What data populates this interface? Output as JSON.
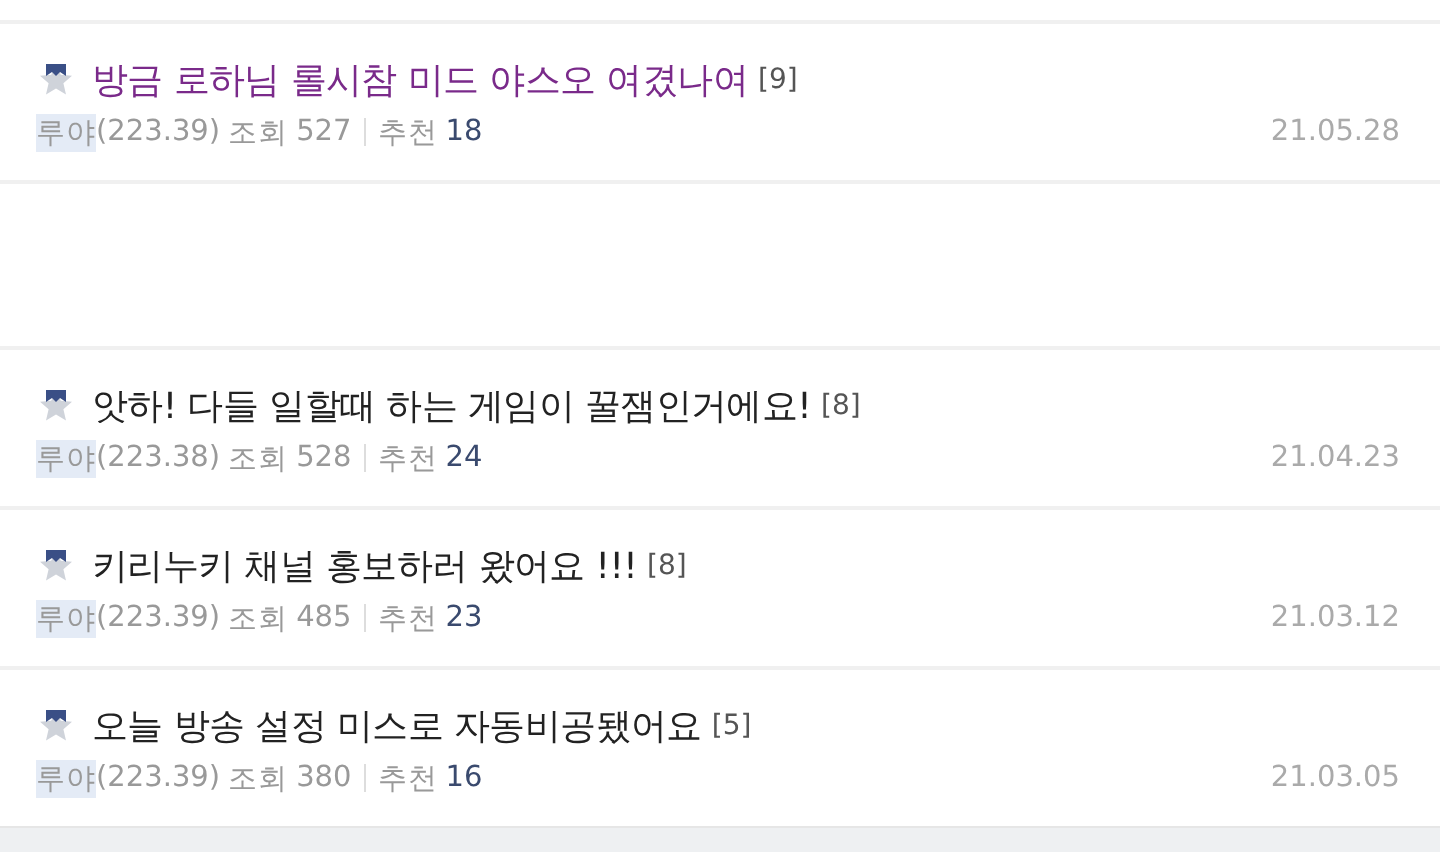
{
  "posts": [
    {
      "kind": "post",
      "title": "방금 로하님 롤시참 미드 야스오 여겼나여",
      "comments": "[9]",
      "visited": true,
      "author": "루야",
      "ip": "(223.39)",
      "views_label": "조회",
      "views": "527",
      "recommend_label": "추천",
      "recommend": "18",
      "date": "21.05.28"
    },
    {
      "kind": "blank"
    },
    {
      "kind": "post",
      "title": "앗하! 다들 일할때 하는 게임이 꿀잼인거에요!",
      "comments": "[8]",
      "visited": false,
      "author": "루야",
      "ip": "(223.38)",
      "views_label": "조회",
      "views": "528",
      "recommend_label": "추천",
      "recommend": "24",
      "date": "21.04.23"
    },
    {
      "kind": "post",
      "title": "키리누키 채널 홍보하러 왔어요 !!!",
      "comments": "[8]",
      "visited": false,
      "author": "루야",
      "ip": "(223.39)",
      "views_label": "조회",
      "views": "485",
      "recommend_label": "추천",
      "recommend": "23",
      "date": "21.03.12"
    },
    {
      "kind": "post",
      "title": "오늘 방송 설정 미스로 자동비공됐어요",
      "comments": "[5]",
      "visited": false,
      "author": "루야",
      "ip": "(223.39)",
      "views_label": "조회",
      "views": "380",
      "recommend_label": "추천",
      "recommend": "16",
      "date": "21.03.05"
    }
  ]
}
